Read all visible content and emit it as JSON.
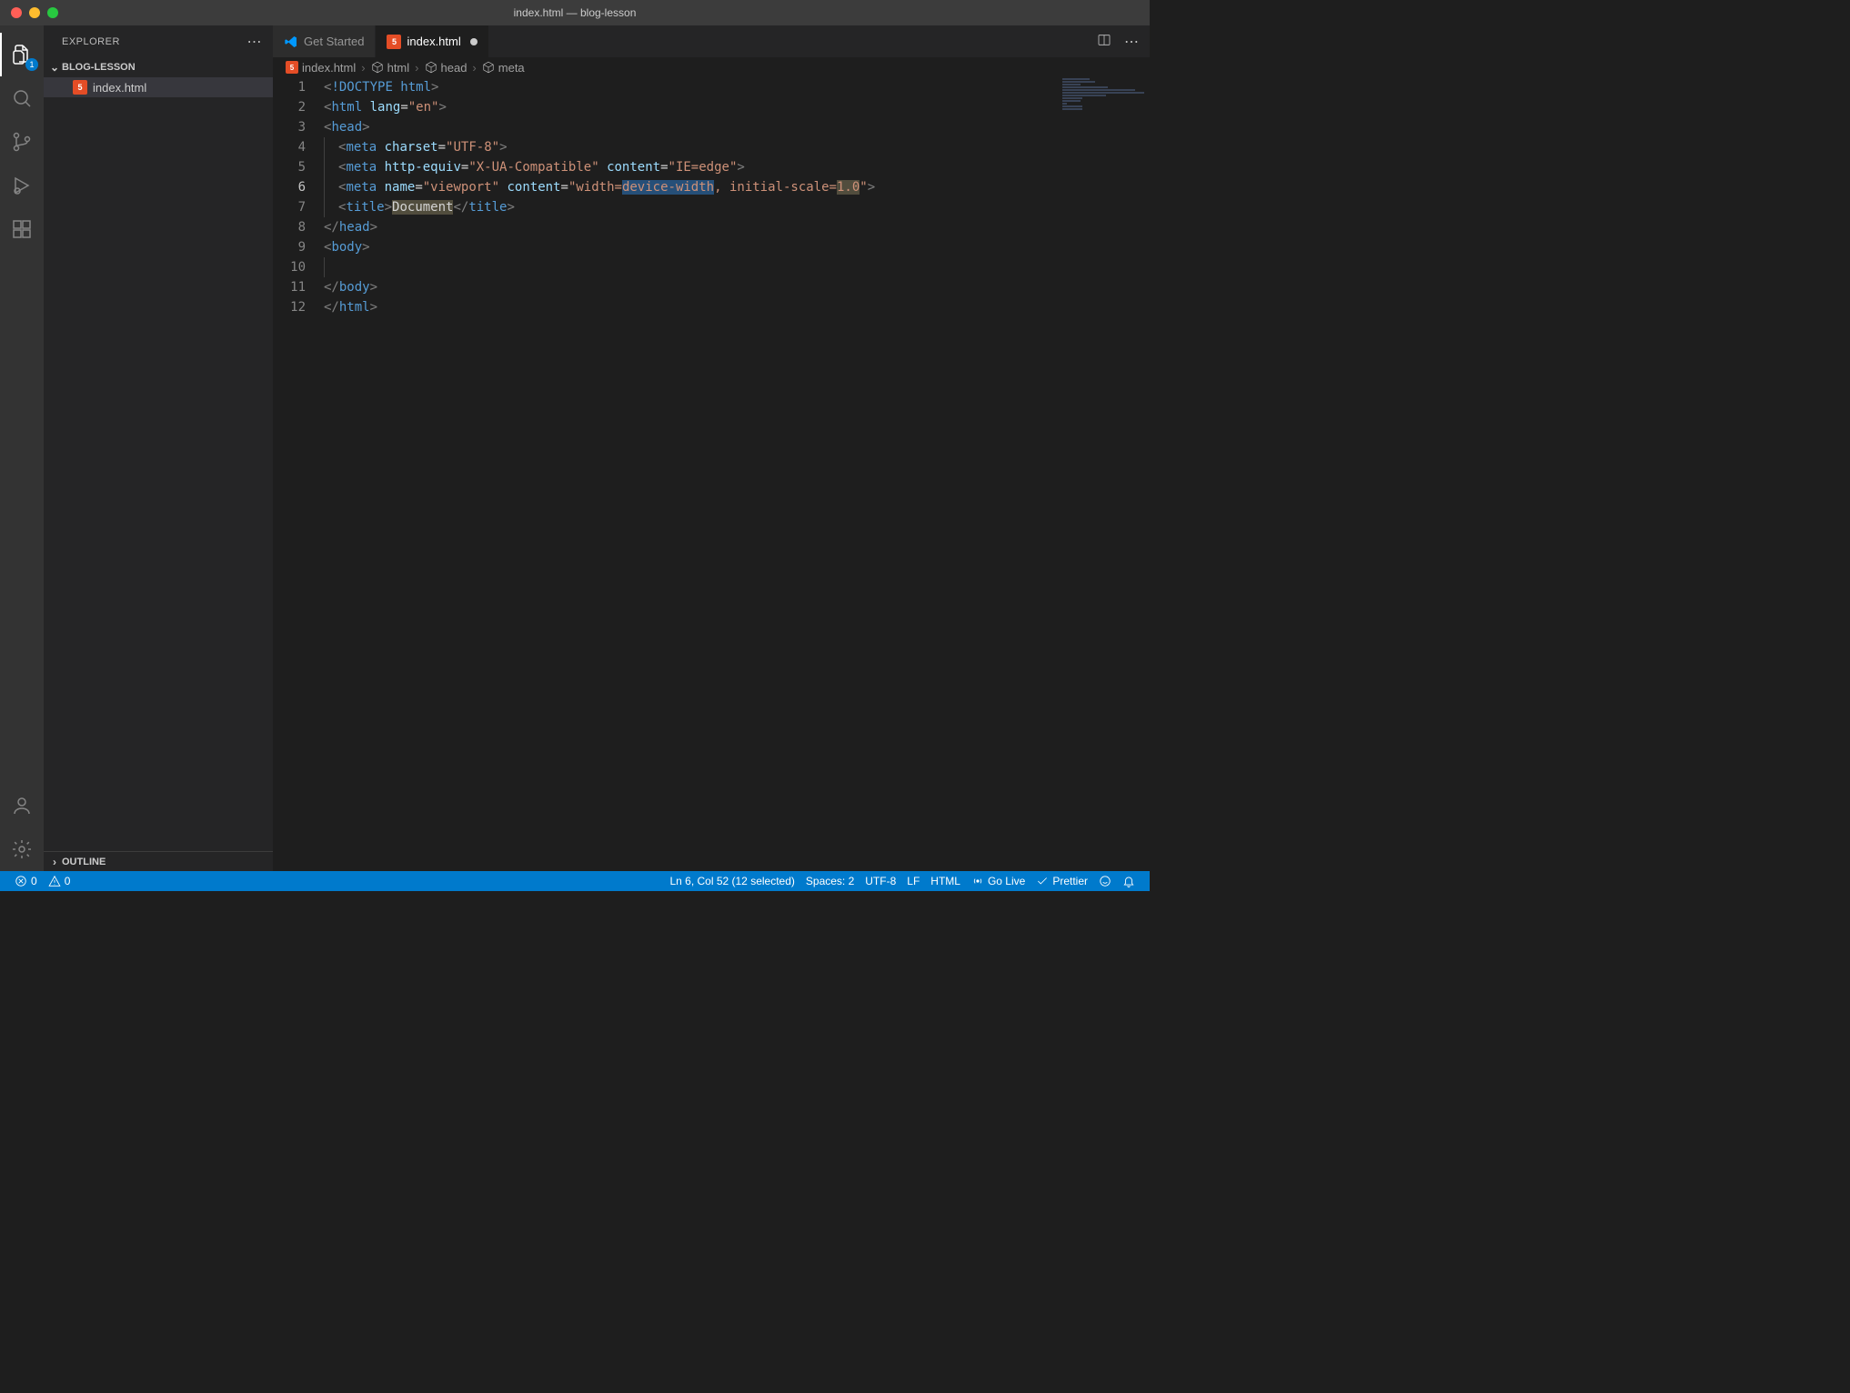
{
  "window": {
    "title": "index.html — blog-lesson"
  },
  "activity": {
    "explorer_badge": "1"
  },
  "sidebar": {
    "title": "EXPLORER",
    "folder": "BLOG-LESSON",
    "files": [
      {
        "name": "index.html"
      }
    ],
    "outline": "OUTLINE"
  },
  "tabs": [
    {
      "label": "Get Started",
      "type": "vscode",
      "dirty": false,
      "active": false
    },
    {
      "label": "index.html",
      "type": "html",
      "dirty": true,
      "active": true
    }
  ],
  "breadcrumb": {
    "file": "index.html",
    "path": [
      "html",
      "head",
      "meta"
    ]
  },
  "code": {
    "currentLine": 6,
    "lines": [
      {
        "n": 1,
        "tokens": [
          [
            "br",
            "<"
          ],
          [
            "doctype",
            "!DOCTYPE "
          ],
          [
            "tag",
            "html"
          ],
          [
            "br",
            ">"
          ]
        ]
      },
      {
        "n": 2,
        "tokens": [
          [
            "br",
            "<"
          ],
          [
            "tag",
            "html"
          ],
          [
            "sp",
            " "
          ],
          [
            "attr",
            "lang"
          ],
          [
            "eq",
            "="
          ],
          [
            "str",
            "\"en\""
          ],
          [
            "br",
            ">"
          ]
        ]
      },
      {
        "n": 3,
        "tokens": [
          [
            "br",
            "<"
          ],
          [
            "tag",
            "head"
          ],
          [
            "br",
            ">"
          ]
        ]
      },
      {
        "n": 4,
        "indent": 1,
        "tokens": [
          [
            "br",
            "<"
          ],
          [
            "tag",
            "meta"
          ],
          [
            "sp",
            " "
          ],
          [
            "attr",
            "charset"
          ],
          [
            "eq",
            "="
          ],
          [
            "str",
            "\"UTF-8\""
          ],
          [
            "br",
            ">"
          ]
        ]
      },
      {
        "n": 5,
        "indent": 1,
        "tokens": [
          [
            "br",
            "<"
          ],
          [
            "tag",
            "meta"
          ],
          [
            "sp",
            " "
          ],
          [
            "attr",
            "http-equiv"
          ],
          [
            "eq",
            "="
          ],
          [
            "str",
            "\"X-UA-Compatible\""
          ],
          [
            "sp",
            " "
          ],
          [
            "attr",
            "content"
          ],
          [
            "eq",
            "="
          ],
          [
            "str",
            "\"IE=edge\""
          ],
          [
            "br",
            ">"
          ]
        ]
      },
      {
        "n": 6,
        "indent": 1,
        "tokens": [
          [
            "br",
            "<"
          ],
          [
            "tag",
            "meta"
          ],
          [
            "sp",
            " "
          ],
          [
            "attr",
            "name"
          ],
          [
            "eq",
            "="
          ],
          [
            "str",
            "\"viewport\""
          ],
          [
            "sp",
            " "
          ],
          [
            "attr",
            "content"
          ],
          [
            "eq",
            "="
          ],
          [
            "str",
            "\"width="
          ],
          [
            "str-sel",
            "device-width"
          ],
          [
            "str",
            ", initial-scale="
          ],
          [
            "str-h",
            "1.0"
          ],
          [
            "str",
            "\""
          ],
          [
            "br",
            ">"
          ]
        ]
      },
      {
        "n": 7,
        "indent": 1,
        "tokens": [
          [
            "br",
            "<"
          ],
          [
            "tag",
            "title"
          ],
          [
            "br",
            ">"
          ],
          [
            "txt-h",
            "Document"
          ],
          [
            "br",
            "</"
          ],
          [
            "tag",
            "title"
          ],
          [
            "br",
            ">"
          ]
        ]
      },
      {
        "n": 8,
        "tokens": [
          [
            "br",
            "</"
          ],
          [
            "tag",
            "head"
          ],
          [
            "br",
            ">"
          ]
        ]
      },
      {
        "n": 9,
        "tokens": [
          [
            "br",
            "<"
          ],
          [
            "tag",
            "body"
          ],
          [
            "br",
            ">"
          ]
        ]
      },
      {
        "n": 10,
        "indent": 1,
        "tokens": []
      },
      {
        "n": 11,
        "tokens": [
          [
            "br",
            "</"
          ],
          [
            "tag",
            "body"
          ],
          [
            "br",
            ">"
          ]
        ]
      },
      {
        "n": 12,
        "tokens": [
          [
            "br",
            "</"
          ],
          [
            "tag",
            "html"
          ],
          [
            "br",
            ">"
          ]
        ]
      }
    ]
  },
  "status": {
    "errors": "0",
    "warnings": "0",
    "cursor": "Ln 6, Col 52 (12 selected)",
    "spaces": "Spaces: 2",
    "encoding": "UTF-8",
    "eol": "LF",
    "language": "HTML",
    "golive": "Go Live",
    "prettier": "Prettier"
  }
}
